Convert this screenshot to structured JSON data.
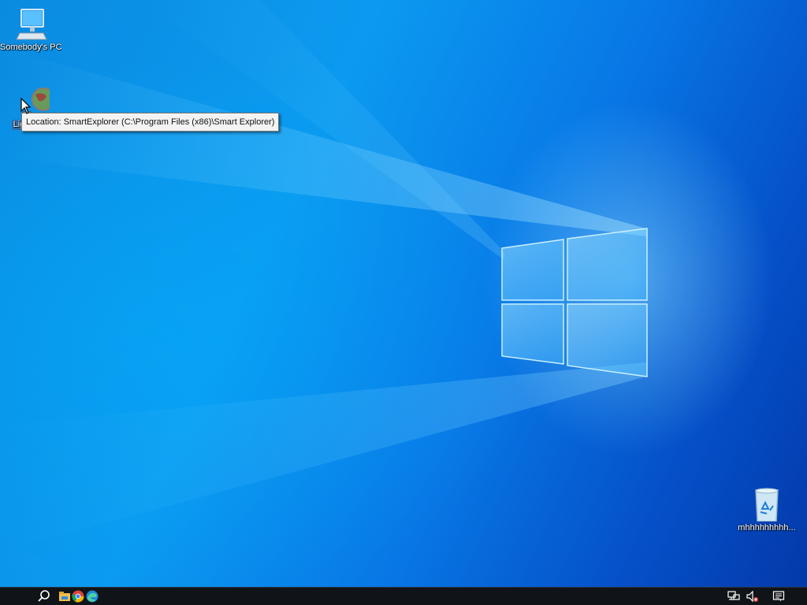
{
  "desktop": {
    "icons": [
      {
        "label": "Somebody's PC",
        "icon": "computer-icon"
      },
      {
        "label": "Lightbulb",
        "icon": "globe-shortcut-icon"
      },
      {
        "label": "mhhhhhhhhh...",
        "icon": "recycle-bin-icon"
      }
    ],
    "tooltip": "Location: SmartExplorer (C:\\Program Files (x86)\\Smart Explorer)"
  },
  "taskbar": {
    "pinned": [
      {
        "name": "search",
        "icon": "search-icon"
      },
      {
        "name": "file-explorer",
        "icon": "folder-icon"
      },
      {
        "name": "chrome",
        "icon": "chrome-icon"
      },
      {
        "name": "edge",
        "icon": "edge-icon"
      }
    ],
    "tray": [
      {
        "name": "network",
        "icon": "network-icon"
      },
      {
        "name": "volume-muted",
        "icon": "volume-muted-icon"
      },
      {
        "name": "action-center",
        "icon": "notification-icon"
      }
    ]
  },
  "colors": {
    "wallpaper_primary": "#0a8be0",
    "wallpaper_dark": "#0338a8",
    "taskbar": "#101418",
    "tooltip_bg": "#f3f3f3"
  }
}
